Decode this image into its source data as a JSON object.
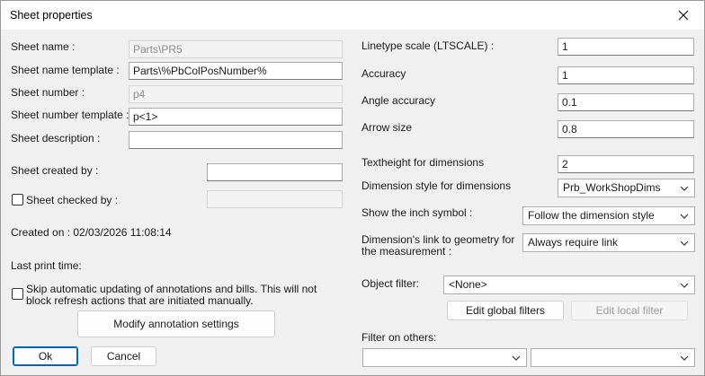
{
  "window": {
    "title": "Sheet properties"
  },
  "left": {
    "sheet_name_label": "Sheet name :",
    "sheet_name_value": "Parts\\PR5",
    "sheet_name_template_label": "Sheet name template :",
    "sheet_name_template_value": "Parts\\%PbColPosNumber%",
    "sheet_number_label": "Sheet number :",
    "sheet_number_value": "p4",
    "sheet_number_template_label": "Sheet number template :",
    "sheet_number_template_value": "p<1>",
    "sheet_description_label": "Sheet description :",
    "sheet_description_value": "",
    "sheet_created_by_label": "Sheet created by :",
    "sheet_created_by_value": "",
    "sheet_checked_by_label": "Sheet checked by :",
    "sheet_checked_by_value": "",
    "created_on_label": "Created on : 02/03/2026  11:08:14",
    "last_print_label": "Last print time:",
    "skip_updating_label": "Skip automatic updating of annotations and bills. This will not block refresh actions that are initiated manually.",
    "modify_annotation_button": "Modify annotation settings",
    "ok_button": "Ok",
    "cancel_button": "Cancel"
  },
  "right": {
    "linetype_scale_label": "Linetype scale (LTSCALE) :",
    "linetype_scale_value": "1",
    "accuracy_label": "Accuracy",
    "accuracy_value": "1",
    "angle_accuracy_label": "Angle accuracy",
    "angle_accuracy_value": "0.1",
    "arrow_size_label": "Arrow size",
    "arrow_size_value": "0.8",
    "textheight_label": "Textheight for dimensions",
    "textheight_value": "2",
    "dimension_style_label": "Dimension style for dimensions",
    "dimension_style_value": "Prb_WorkShopDims",
    "inch_symbol_label": "Show the inch symbol :",
    "inch_symbol_value": "Follow the dimension style",
    "link_geometry_label": "Dimension's link to geometry for the measurement :",
    "link_geometry_value": "Always require link",
    "object_filter_label": "Object filter:",
    "object_filter_value": "<None>",
    "edit_global_filters_button": "Edit global filters",
    "edit_local_filter_button": "Edit local filter",
    "filter_on_others_label": "Filter on others:",
    "filter_on_others_value_1": "",
    "filter_on_others_value_2": ""
  }
}
